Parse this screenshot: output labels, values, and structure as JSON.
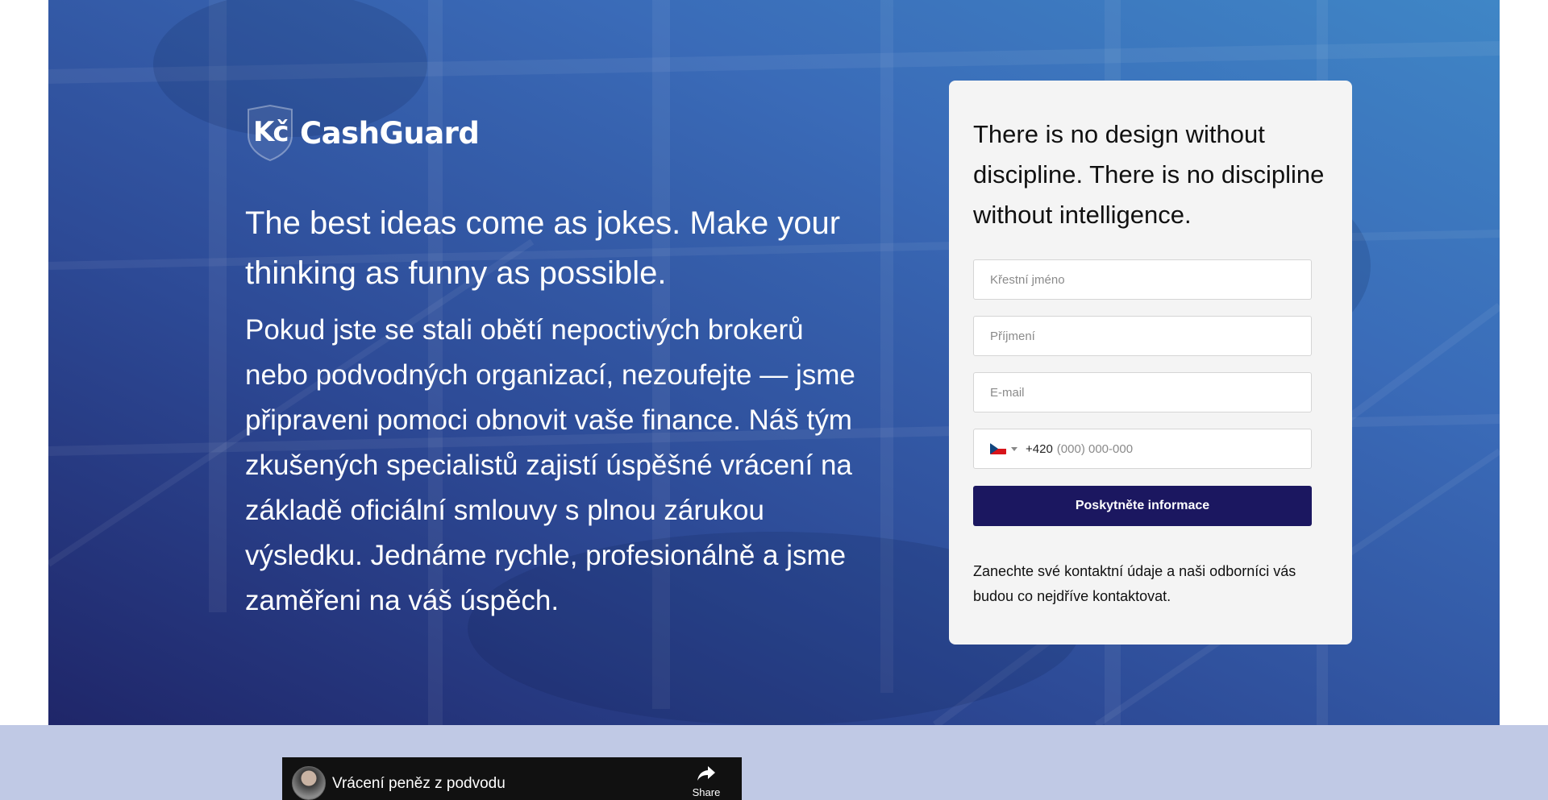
{
  "brand": {
    "logo_mark": "Kč",
    "logo_text": "CashGuard"
  },
  "hero": {
    "headline": "The best ideas come as jokes. Make your thinking as funny as possible.",
    "body": "Pokud jste se stali obětí nepoctivých brokerů nebo podvodných organizací, nezoufejte — jsme připraveni pomoci obnovit vaše finance. Náš tým zkušených specialistů zajistí úspěšné vrácení na základě oficiální smlouvy s plnou zárukou výsledku. Jednáme rychle, profesionálně a jsme zaměřeni na váš úspěch."
  },
  "form": {
    "title": "There is no design without discipline. There is no discipline without intelligence.",
    "first_name_placeholder": "Křestní jméno",
    "last_name_placeholder": "Příjmení",
    "email_placeholder": "E-mail",
    "phone_dial_code": "+420",
    "phone_placeholder": "(000) 000-000",
    "phone_flag": "czech-flag-icon",
    "submit_label": "Poskytněte informace",
    "note": "Zanechte své kontaktní údaje a naši odborníci vás budou co nejdříve kontaktovat."
  },
  "video": {
    "title": "Vrácení peněz z podvodu",
    "share_label": "Share"
  },
  "colors": {
    "submit_bg": "#1b1760",
    "card_bg": "#f4f4f4",
    "lower_bg": "#c0c9e5",
    "hero_gradient_dark": "#1f2669",
    "hero_gradient_light": "#3f86c6"
  }
}
